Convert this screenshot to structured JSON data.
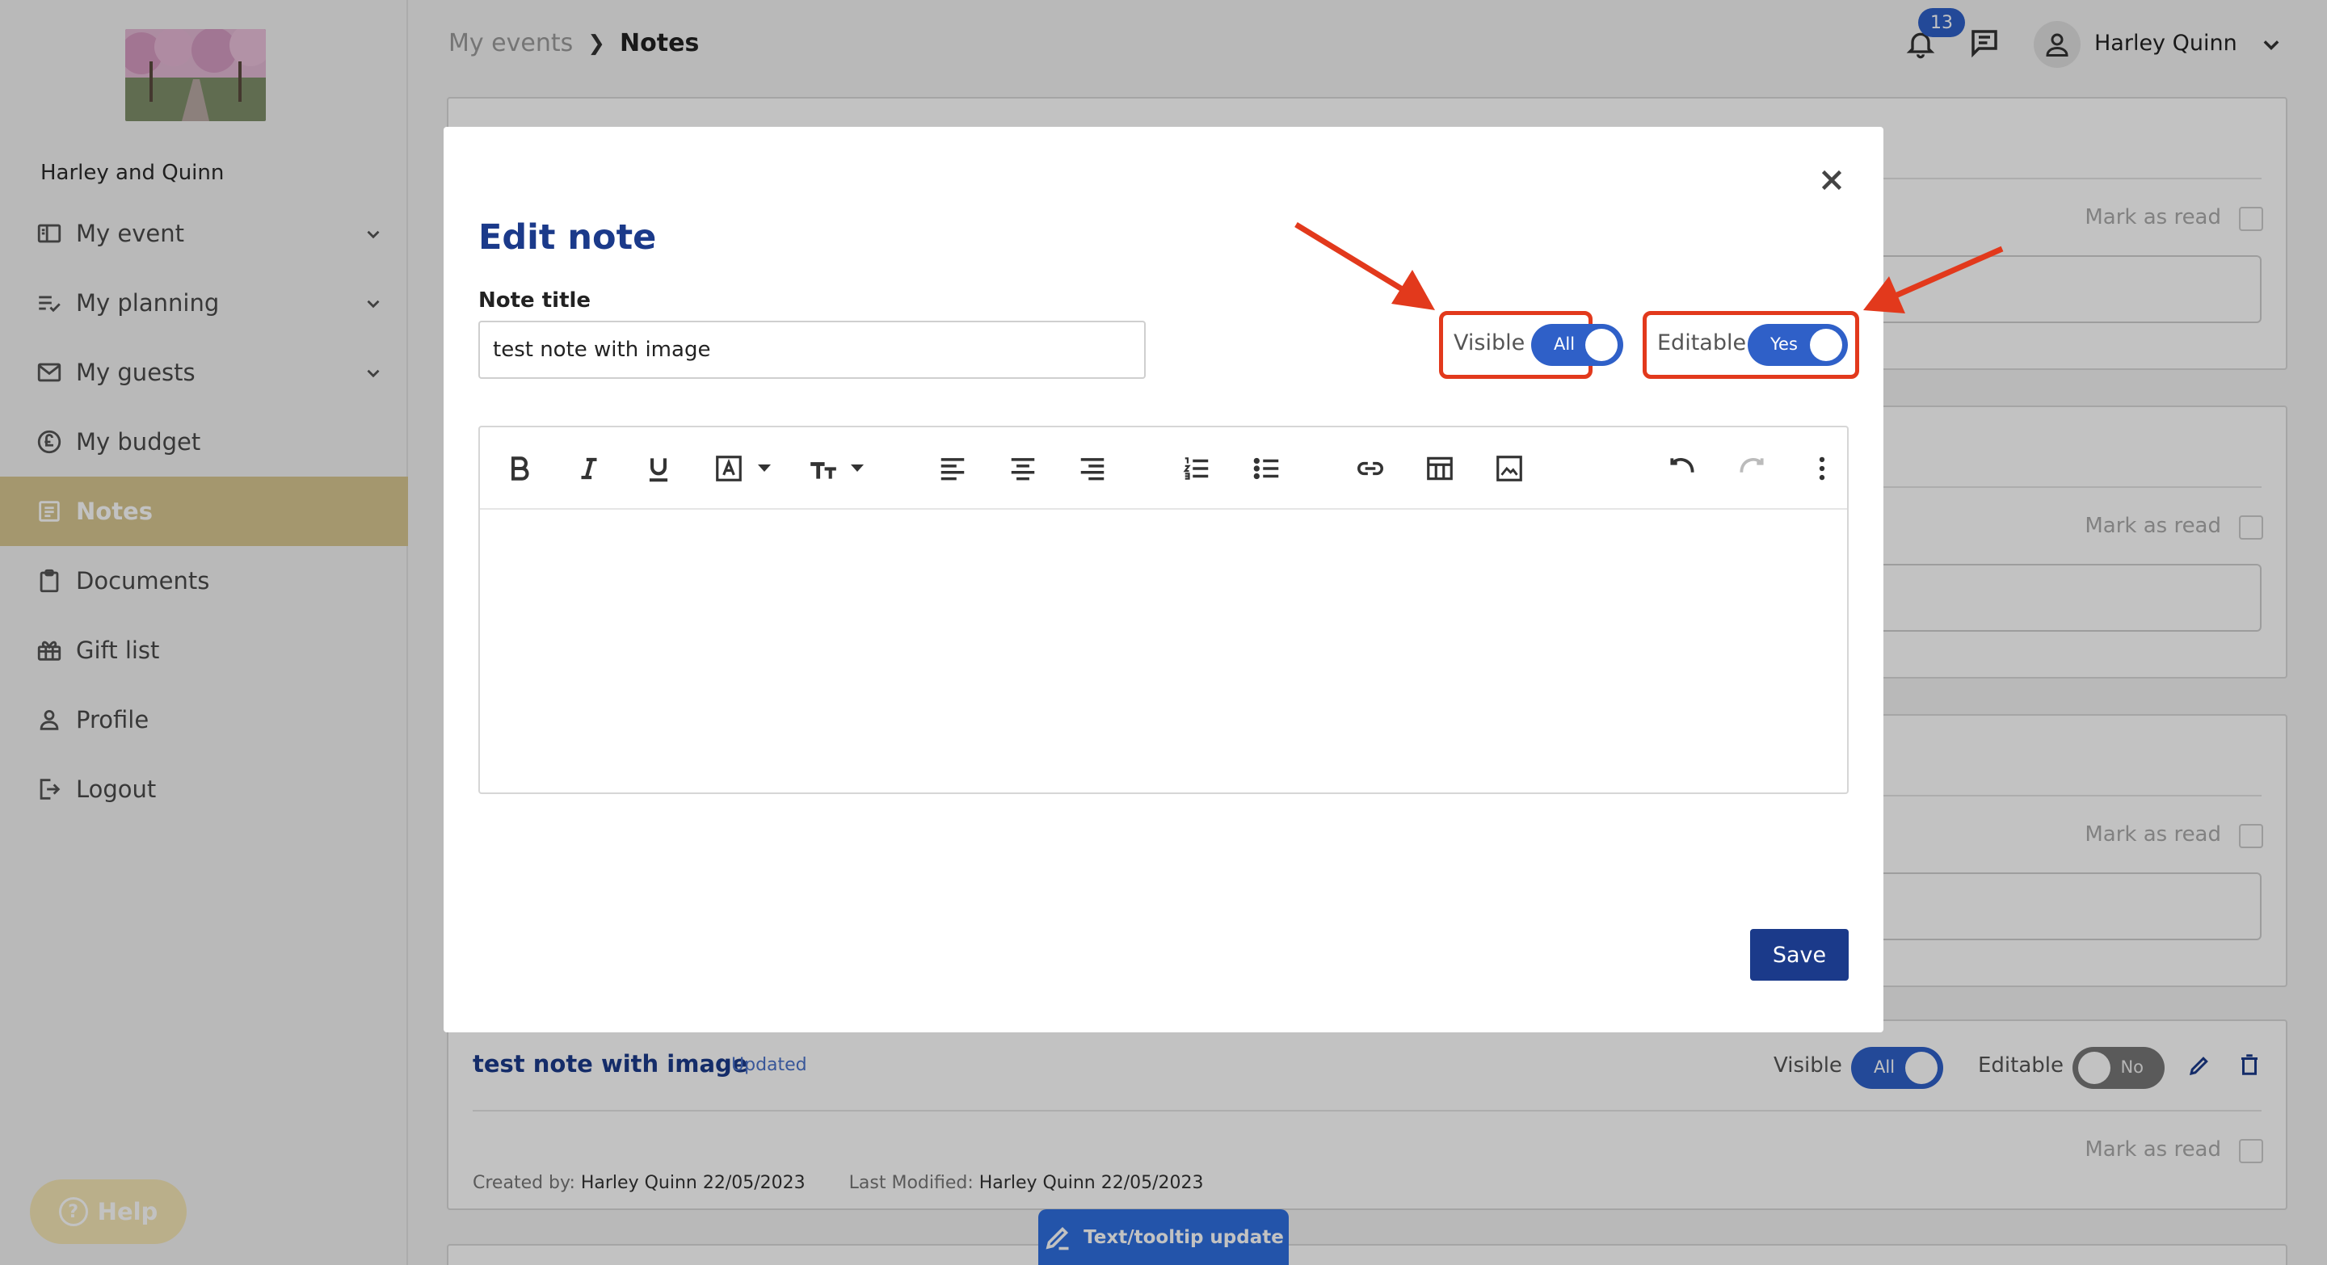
{
  "sidebar": {
    "event_name": "Harley and Quinn",
    "items": [
      {
        "label": "My event",
        "icon": "book-icon"
      },
      {
        "label": "My planning",
        "icon": "checklist-icon"
      },
      {
        "label": "My guests",
        "icon": "mail-icon"
      },
      {
        "label": "My budget",
        "icon": "pound-icon"
      },
      {
        "label": "Notes",
        "icon": "notes-icon"
      },
      {
        "label": "Documents",
        "icon": "clipboard-icon"
      },
      {
        "label": "Gift list",
        "icon": "gift-icon"
      },
      {
        "label": "Profile",
        "icon": "person-icon"
      },
      {
        "label": "Logout",
        "icon": "logout-icon"
      }
    ],
    "help_label": "Help"
  },
  "header": {
    "breadcrumb_parent": "My events",
    "breadcrumb_current": "Notes",
    "notification_count": "13",
    "user_name": "Harley Quinn"
  },
  "notes_list": {
    "mark_as_read": "Mark as read",
    "last_note": {
      "title": "test note with image",
      "status": "Updated",
      "visible_label": "Visible",
      "visible_value": "All",
      "editable_label": "Editable",
      "editable_value": "No",
      "created_label": "Created by:",
      "created_value": "Harley Quinn 22/05/2023",
      "modified_label": "Last Modified:",
      "modified_value": "Harley Quinn 22/05/2023"
    }
  },
  "modal": {
    "title": "Edit note",
    "note_title_label": "Note title",
    "note_title_value": "test note with image",
    "visible_label": "Visible",
    "visible_value": "All",
    "editable_label": "Editable",
    "editable_value": "Yes",
    "save_label": "Save"
  },
  "tooltip_update": "Text/tooltip update",
  "colors": {
    "brand_blue": "#1b3a8a",
    "toggle_blue": "#2f60c8",
    "active_gold": "#d8c791",
    "highlight_red": "#e2391c"
  }
}
